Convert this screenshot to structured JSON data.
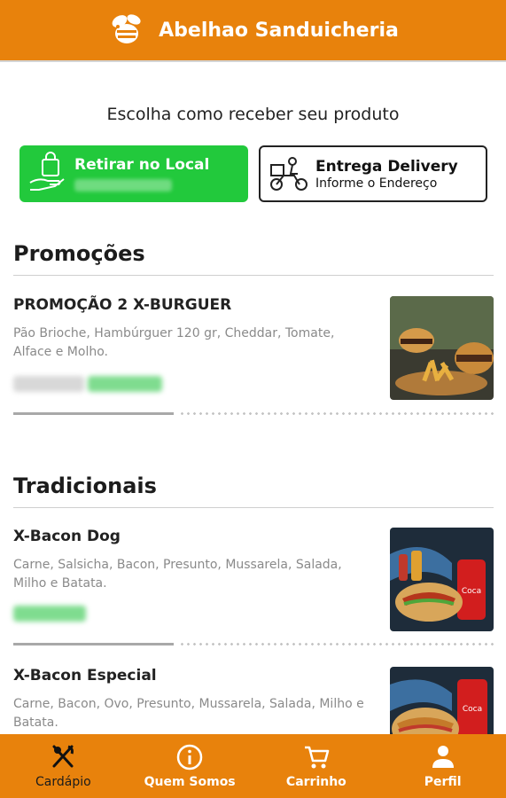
{
  "header": {
    "title": "Abelhao Sanduicheria",
    "logo_icon": "bee-icon"
  },
  "receive": {
    "title": "Escolha como receber seu produto",
    "pickup": {
      "label": "Retirar no Local",
      "icon": "pickup-bag-hand-icon",
      "color": "#22c93c"
    },
    "delivery": {
      "label": "Entrega Delivery",
      "sublabel": "Informe o Endereço",
      "icon": "delivery-scooter-icon"
    }
  },
  "sections": [
    {
      "title": "Promoções",
      "items": [
        {
          "name": "PROMOÇÃO 2 X-BURGUER",
          "description": "Pão Brioche, Hambúrguer 120 gr, Cheddar, Tomate, Alface e Molho."
        }
      ]
    },
    {
      "title": "Tradicionais",
      "items": [
        {
          "name": "X-Bacon Dog",
          "description": "Carne, Salsicha, Bacon, Presunto, Mussarela, Salada, Milho e Batata."
        },
        {
          "name": "X-Bacon Especial",
          "description": "Carne, Bacon, Ovo, Presunto, Mussarela, Salada, Milho e Batata."
        }
      ]
    }
  ],
  "nav": [
    {
      "label": "Cardápio",
      "icon": "fork-knife-icon",
      "active": true
    },
    {
      "label": "Quem Somos",
      "icon": "info-icon"
    },
    {
      "label": "Carrinho",
      "icon": "cart-icon"
    },
    {
      "label": "Perfil",
      "icon": "person-icon"
    }
  ],
  "colors": {
    "brand": "#e8820c",
    "pickup": "#22c93c",
    "price": "#22c93c"
  }
}
